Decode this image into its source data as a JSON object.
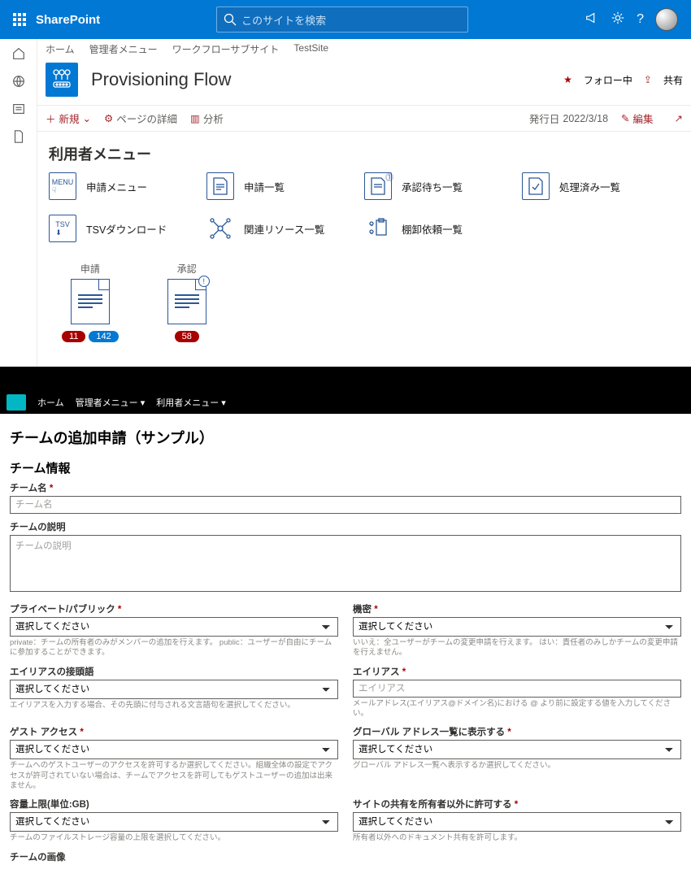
{
  "header": {
    "brand": "SharePoint",
    "search_placeholder": "このサイトを検索"
  },
  "crumbs": [
    "ホーム",
    "管理者メニュー",
    "ワークフローサブサイト",
    "TestSite"
  ],
  "site": {
    "title": "Provisioning Flow",
    "follow": "フォロー中",
    "share": "共有"
  },
  "cmdbar": {
    "new": "新規",
    "details": "ページの詳細",
    "analytics": "分析",
    "published_label": "発行日",
    "published_date": "2022/3/18",
    "edit": "編集"
  },
  "section_title": "利用者メニュー",
  "menu": [
    {
      "label": "申請メニュー",
      "icon": "MENU"
    },
    {
      "label": "申請一覧",
      "icon": "DOC"
    },
    {
      "label": "承認待ち一覧",
      "icon": "DOC!"
    },
    {
      "label": "処理済み一覧",
      "icon": "DOC✓"
    },
    {
      "label": "TSVダウンロード",
      "icon": "TSV"
    },
    {
      "label": "関連リソース一覧",
      "icon": "NET"
    },
    {
      "label": "棚卸依頼一覧",
      "icon": "CLIP"
    }
  ],
  "tiles": [
    {
      "label": "申請",
      "badges": [
        {
          "n": "11",
          "c": "red"
        },
        {
          "n": "142",
          "c": "blue"
        }
      ],
      "mark": ""
    },
    {
      "label": "承認",
      "badges": [
        {
          "n": "58",
          "c": "red"
        }
      ],
      "mark": "!"
    }
  ],
  "form_topbar": {
    "home": "ホーム",
    "admin": "管理者メニュー ▾",
    "user": "利用者メニュー ▾"
  },
  "form": {
    "h1": "チームの追加申請（サンプル）",
    "h2": "チーム情報",
    "team_name_label": "チーム名",
    "team_name_ph": "チーム名",
    "team_desc_label": "チームの説明",
    "team_desc_ph": "チームの説明",
    "privacy_label": "プライベート/パブリック",
    "privacy_help": "private：チームの所有者のみがメンバーの追加を行えます。 public：ユーザーが自由にチームに参加することができます。",
    "secret_label": "機密",
    "secret_help": "いいえ：全ユーザーがチームの変更申請を行えます。 はい：責任者のみしかチームの変更申請を行えません。",
    "alias_suffix_label": "エイリアスの接頭語",
    "alias_suffix_help": "エイリアスを入力する場合、その先頭に付与される文言語句を選択してください。",
    "alias_label": "エイリアス",
    "alias_ph": "エイリアス",
    "alias_help": "メールアドレス(エイリアス@ドメイン名)における @ より前に設定する値を入力してください。",
    "guest_label": "ゲスト アクセス",
    "guest_help": "チームへのゲストユーザーのアクセスを許可するか選択してください。組織全体の設定でアクセスが許可されていない場合は、チームでアクセスを許可してもゲストユーザーの追加は出来ません。",
    "gal_label": "グローバル アドレス一覧に表示する",
    "gal_help": "グローバル アドレス一覧へ表示するか選択してください。",
    "capacity_label": "容量上限(単位:GB)",
    "capacity_help": "チームのファイルストレージ容量の上限を選択してください。",
    "sharing_label": "サイトの共有を所有者以外に許可する",
    "sharing_help": "所有者以外へのドキュメント共有を許可します。",
    "image_label": "チームの画像",
    "select_ph": "選択してください"
  }
}
